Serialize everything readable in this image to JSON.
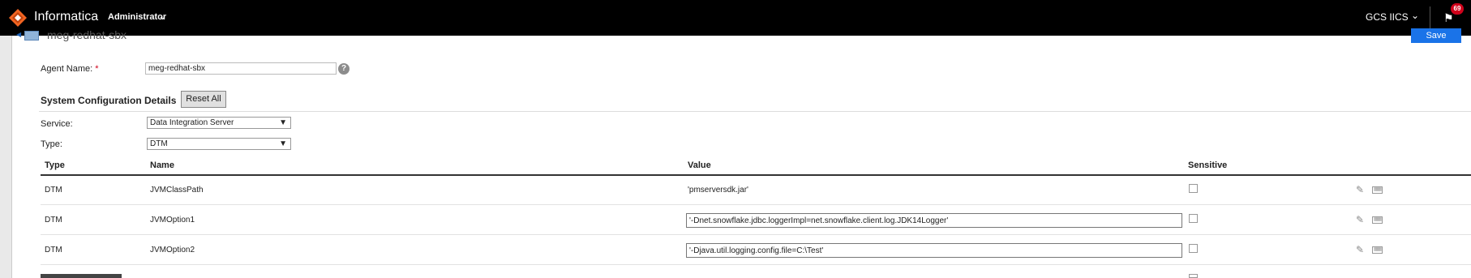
{
  "header": {
    "brand": "Informatica",
    "role": "Administrator",
    "org": "GCS IICS",
    "notifications_count": "69"
  },
  "agent": {
    "breadcrumb_name": "meg-redhat-sbx",
    "save_label": "Save",
    "name_label": "Agent Name:",
    "required_marker": "*",
    "name_value": "meg-redhat-sbx"
  },
  "config": {
    "section_title": "System Configuration Details",
    "reset_label": "Reset All",
    "service_label": "Service:",
    "service_value": "Data Integration Server",
    "type_label": "Type:",
    "type_value": "DTM"
  },
  "table": {
    "columns": [
      "Type",
      "Name",
      "Value",
      "Sensitive"
    ],
    "rows": [
      {
        "type": "DTM",
        "name": "JVMClassPath",
        "value": "'pmserversdk.jar'",
        "editable": false,
        "sensitive": false
      },
      {
        "type": "DTM",
        "name": "JVMOption1",
        "value": "'-Dnet.snowflake.jdbc.loggerImpl=net.snowflake.client.log.JDK14Logger'",
        "editable": true,
        "sensitive": false
      },
      {
        "type": "DTM",
        "name": "JVMOption2",
        "value": "'-Djava.util.logging.config.file=C:\\Test'",
        "editable": true,
        "sensitive": false
      }
    ]
  },
  "icons": {
    "logo": "informatica-logo",
    "user_menu": "chevron-down-icon",
    "notifications": "flag-icon",
    "help": "help-icon",
    "edit": "pencil-icon",
    "details": "grid-icon"
  },
  "colors": {
    "topbar": "#000000",
    "accent": "#1a73e8",
    "logo_orange": "#f26522",
    "badge": "#d0021b"
  }
}
